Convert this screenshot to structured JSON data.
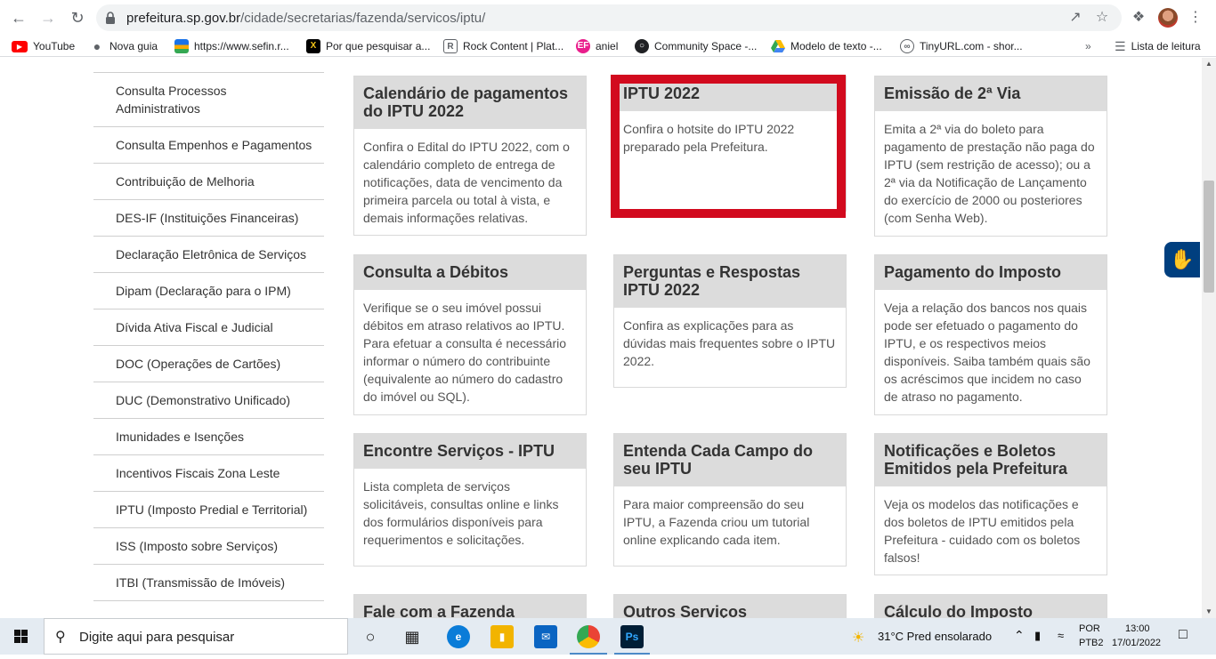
{
  "browser": {
    "url_host": "prefeitura.sp.gov.br",
    "url_path": "/cidade/secretarias/fazenda/servicos/iptu/",
    "reading_list_label": "Lista de leitura",
    "bookmarks": [
      {
        "label": "YouTube",
        "icon": "youtube-icon",
        "color": "#ff0000"
      },
      {
        "label": "Nova guia",
        "icon": "globe-icon",
        "color": "#5f6368"
      },
      {
        "label": "https://www.sefin.r...",
        "icon": "sefin-icon",
        "color": "#1a73e8"
      },
      {
        "label": "Por que pesquisar a...",
        "icon": "x-logo-icon",
        "color": "#000000"
      },
      {
        "label": "Rock Content | Plat...",
        "icon": "rock-content-icon",
        "color": "#5f6368"
      },
      {
        "label": "aniel",
        "icon": "ef-icon",
        "color": "#e91e8c"
      },
      {
        "label": "Community Space -...",
        "icon": "community-icon",
        "color": "#202124"
      },
      {
        "label": "Modelo de texto -...",
        "icon": "google-drive-icon",
        "color": "#34a853"
      },
      {
        "label": "TinyURL.com - shor...",
        "icon": "tinyurl-icon",
        "color": "#5f6368"
      }
    ]
  },
  "sidebar": {
    "items": [
      {
        "label": "Consulta Processos Administrativos"
      },
      {
        "label": "Consulta Empenhos e Pagamentos"
      },
      {
        "label": "Contribuição de Melhoria"
      },
      {
        "label": "DES-IF (Instituições Financeiras)"
      },
      {
        "label": "Declaração Eletrônica de Serviços"
      },
      {
        "label": "Dipam (Declaração para o IPM)"
      },
      {
        "label": "Dívida Ativa Fiscal e Judicial"
      },
      {
        "label": "DOC (Operações de Cartões)"
      },
      {
        "label": "DUC (Demonstrativo Unificado)"
      },
      {
        "label": "Imunidades e Isenções"
      },
      {
        "label": "Incentivos Fiscais Zona Leste"
      },
      {
        "label": "IPTU (Imposto Predial e Territorial)"
      },
      {
        "label": "ISS (Imposto sobre Serviços)"
      },
      {
        "label": "ITBI (Transmissão de Imóveis)"
      }
    ]
  },
  "cards": [
    {
      "title": "Calendário de pagamentos do IPTU 2022",
      "text": "Confira o Edital do IPTU 2022, com o calendário completo de entrega de notificações, data de vencimento da primeira parcela ou total à vista, e demais informações relativas."
    },
    {
      "title": "IPTU 2022",
      "text": "Confira o hotsite do IPTU 2022 preparado pela Prefeitura."
    },
    {
      "title": "Emissão de 2ª Via",
      "text": "Emita a 2ª via do boleto para pagamento de prestação não paga do IPTU (sem restrição de acesso); ou a 2ª via da Notificação de Lançamento do exercício de 2000 ou posteriores (com Senha Web)."
    },
    {
      "title": "Consulta a Débitos",
      "text": "Verifique se o seu imóvel possui débitos em atraso relativos ao IPTU. Para efetuar a consulta é necessário informar o número do contribuinte (equivalente ao número do cadastro do imóvel ou SQL)."
    },
    {
      "title": "Perguntas e Respostas IPTU 2022",
      "text": "Confira as explicações para as dúvidas mais frequentes sobre o IPTU 2022."
    },
    {
      "title": "Pagamento do Imposto",
      "text": "Veja a relação dos bancos nos quais pode ser efetuado o pagamento do IPTU, e os respectivos meios disponíveis. Saiba também quais são os acréscimos que incidem no caso de atraso no pagamento."
    },
    {
      "title": "Encontre Serviços - IPTU",
      "text": "Lista completa de serviços solicitáveis, consultas online e links dos formulários disponíveis para requerimentos e solicitações."
    },
    {
      "title": "Entenda Cada Campo do seu IPTU",
      "text": "Para maior compreensão do seu IPTU, a Fazenda criou um tutorial online explicando cada item."
    },
    {
      "title": "Notificações e Boletos Emitidos pela Prefeitura",
      "text": "Veja os modelos das notificações e dos boletos de IPTU emitidos pela Prefeitura - cuidado com os boletos falsos!"
    },
    {
      "title": "Fale com a Fazenda",
      "text": ""
    },
    {
      "title": "Outros Serviços",
      "text": ""
    },
    {
      "title": "Cálculo do Imposto",
      "text": ""
    }
  ],
  "highlight_color": "#d20a1e",
  "taskbar": {
    "search_placeholder": "Digite aqui para pesquisar",
    "weather": "31°C  Pred ensolarado",
    "lang_top": "POR",
    "lang_bottom": "PTB2",
    "time": "13:00",
    "date": "17/01/2022"
  }
}
